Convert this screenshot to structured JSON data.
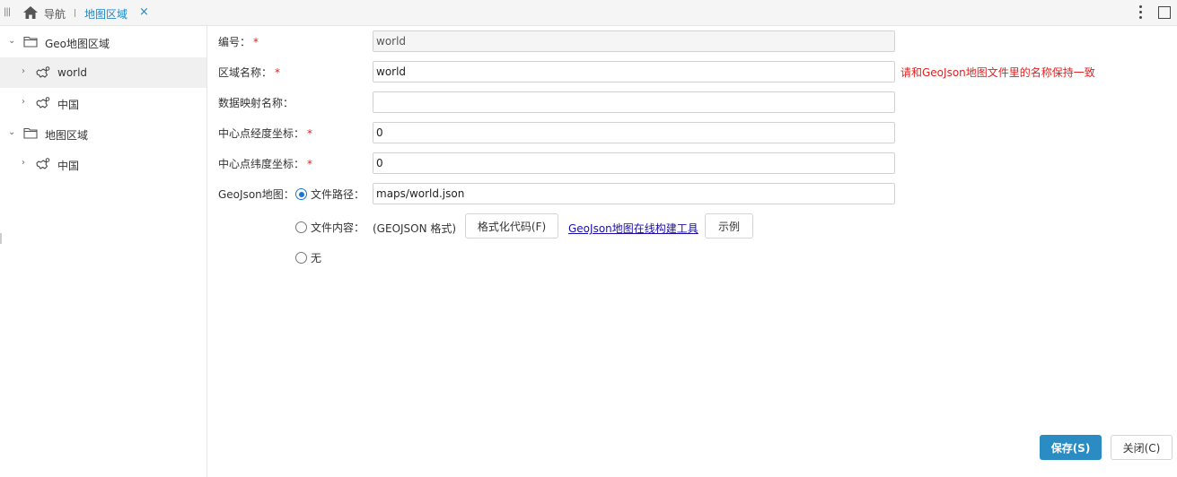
{
  "topbar": {
    "menu_icon": "menu-icon",
    "home_icon": "home-icon",
    "home_label": "导航",
    "active_tab_label": "地图区域",
    "close_glyph": "×"
  },
  "sidebar": {
    "items": [
      {
        "label": "Geo地图区域",
        "icon": "folder-icon",
        "expanded": true
      },
      {
        "label": "world",
        "icon": "map-icon",
        "expanded": false,
        "selected": true
      },
      {
        "label": "中国",
        "icon": "map-icon",
        "expanded": false
      },
      {
        "label": "地图区域",
        "icon": "folder-icon",
        "expanded": true
      },
      {
        "label": "中国",
        "icon": "map-icon",
        "expanded": false
      }
    ]
  },
  "form": {
    "code": {
      "label": "编号：",
      "required": "*",
      "value": "world"
    },
    "region_name": {
      "label": "区域名称：",
      "required": "*",
      "value": "world",
      "hint": "请和GeoJson地图文件里的名称保持一致"
    },
    "data_map_name": {
      "label": "数据映射名称：",
      "value": ""
    },
    "center_lng": {
      "label": "中心点经度坐标：",
      "required": "*",
      "value": "0"
    },
    "center_lat": {
      "label": "中心点纬度坐标：",
      "required": "*",
      "value": "0"
    },
    "geojson": {
      "label": "GeoJson地图：",
      "option_path": "文件路径：",
      "path_value": "maps/world.json",
      "option_content": "文件内容：",
      "format_note": "(GEOJSON 格式)",
      "format_button": "格式化代码(F)",
      "builder_link": "GeoJson地图在线构建工具",
      "example_button": "示例",
      "option_none": "无",
      "selected": "path"
    }
  },
  "footer": {
    "save_label": "保存(S)",
    "close_label": "关闭(C)"
  },
  "colors": {
    "accent": "#2b8cc4",
    "tab_active": "#1e88c7",
    "required": "#e02020",
    "link": "#1a0dab"
  }
}
